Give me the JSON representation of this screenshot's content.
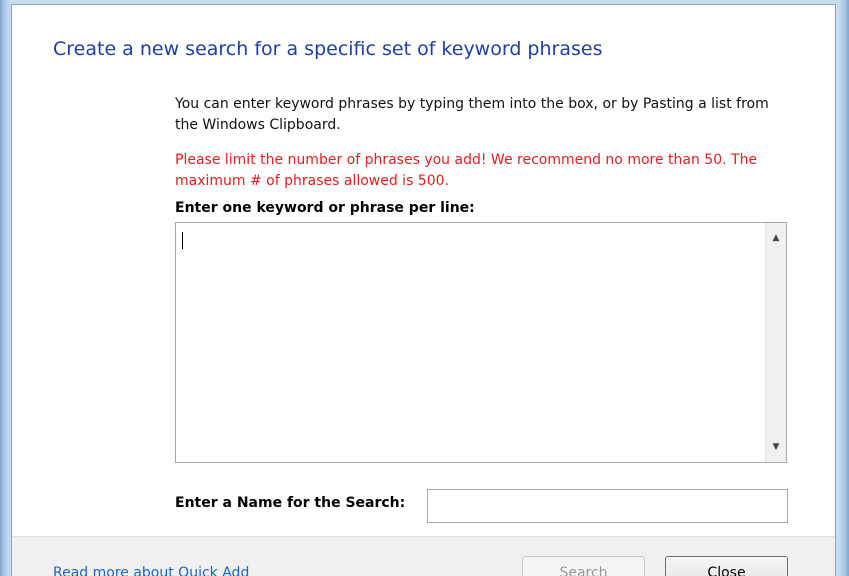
{
  "dialog": {
    "title": "Create a new search for a specific set of keyword phrases",
    "intro": "You can enter keyword phrases by typing them into the box, or by Pasting a list from the Windows Clipboard.",
    "warning": "Please limit the number of phrases you add! We recommend no more than 50. The maximum # of phrases allowed is 500.",
    "keywords_label": "Enter one keyword or phrase per line:",
    "keywords_value": "",
    "name_label": "Enter a Name for the Search:",
    "name_value": ""
  },
  "footer": {
    "read_more_link": "Read more about Quick Add",
    "search_button": "Search",
    "close_button": "Close"
  },
  "icons": {
    "scroll_up": "scroll-up-arrow-icon",
    "scroll_down": "scroll-down-arrow-icon"
  },
  "colors": {
    "title": "#1c3fa8",
    "warning": "#e81c1c",
    "link": "#1c63c8"
  }
}
